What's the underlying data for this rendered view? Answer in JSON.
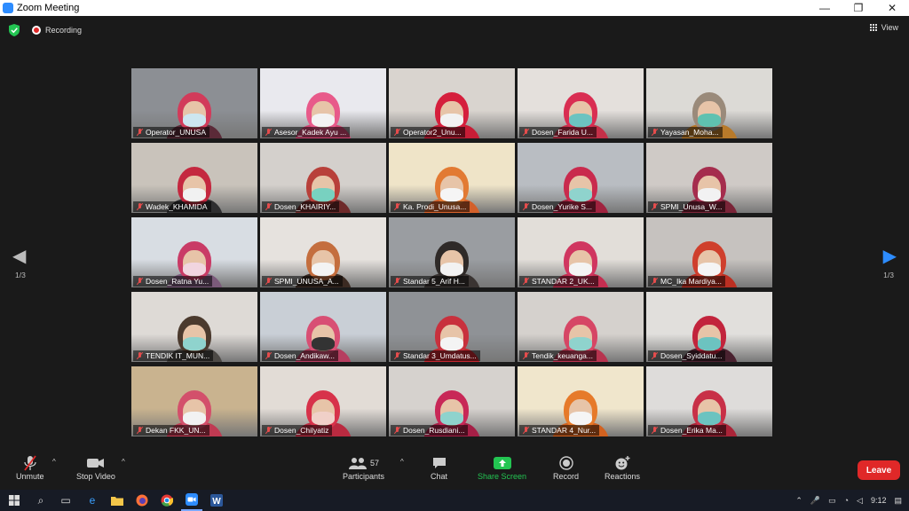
{
  "window": {
    "title": "Zoom Meeting",
    "minimize": "—",
    "restore": "❐",
    "close": "✕"
  },
  "status": {
    "recording_label": "Recording",
    "view_label": "View"
  },
  "gallery": {
    "tiles": [
      {
        "name": "Operator_UNUSA",
        "active": true
      },
      {
        "name": "Asesor_Kadek Ayu ..."
      },
      {
        "name": "Operator2_Unu..."
      },
      {
        "name": "Dosen_Farida U..."
      },
      {
        "name": "Yayasan_Moha..."
      },
      {
        "name": "Wadek_KHAMIDA"
      },
      {
        "name": "Dosen_KHAIRIY..."
      },
      {
        "name": "Ka. Prodi_Unusa..."
      },
      {
        "name": "Dosen_Yurike S..."
      },
      {
        "name": "SPMI_Unusa_W..."
      },
      {
        "name": "Dosen_Ratna Yu..."
      },
      {
        "name": "SPMI_UNUSA_A..."
      },
      {
        "name": "Standar 5_Arif H..."
      },
      {
        "name": "STANDAR 2_UK..."
      },
      {
        "name": "MC_Ika Mardiya..."
      },
      {
        "name": "TENDIK IT_MUN..."
      },
      {
        "name": "Dosen_Andikaw..."
      },
      {
        "name": "Standar 3_Umdatus..."
      },
      {
        "name": "Tendik_keuanga..."
      },
      {
        "name": "Dosen_Syiddatu..."
      },
      {
        "name": "Dekan FKK_UN..."
      },
      {
        "name": "Dosen_Chilyatiz"
      },
      {
        "name": "Dosen_Rusdiani..."
      },
      {
        "name": "STANDAR 4_Nur..."
      },
      {
        "name": "Dosen_Erika Ma..."
      }
    ],
    "page_left": "1/3",
    "page_right": "1/3"
  },
  "toolbar": {
    "unmute": "Unmute",
    "stop_video": "Stop Video",
    "participants": "Participants",
    "participants_count": "57",
    "chat": "Chat",
    "share_screen": "Share Screen",
    "record": "Record",
    "reactions": "Reactions",
    "leave": "Leave"
  },
  "taskbar": {
    "time": "9:12"
  },
  "colors": {
    "accent": "#2d8cff",
    "share_green": "#23c552",
    "leave_red": "#e02828",
    "active_speaker": "#d6e34b"
  }
}
